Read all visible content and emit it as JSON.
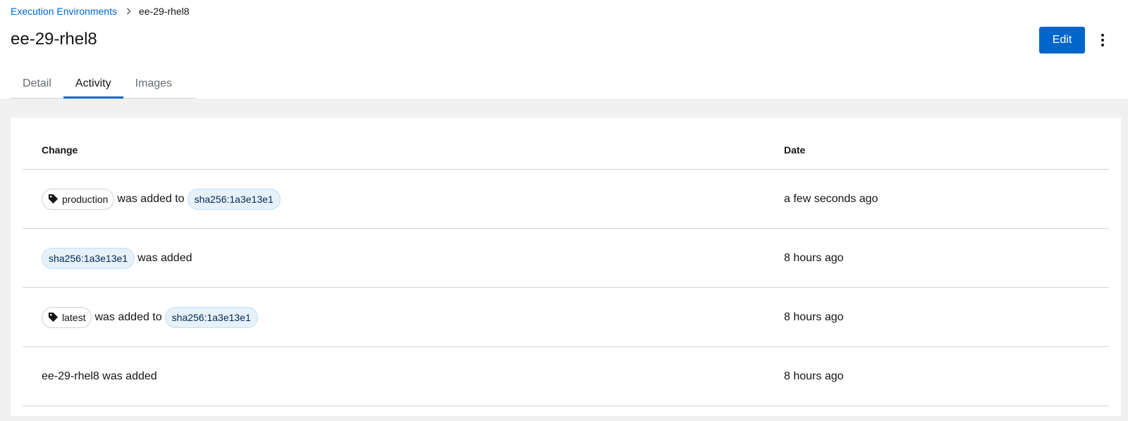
{
  "breadcrumb": {
    "parent": "Execution Environments",
    "current": "ee-29-rhel8"
  },
  "page_title": "ee-29-rhel8",
  "actions": {
    "edit_label": "Edit"
  },
  "tabs": [
    {
      "label": "Detail"
    },
    {
      "label": "Activity"
    },
    {
      "label": "Images"
    }
  ],
  "activity_table": {
    "headers": {
      "change": "Change",
      "date": "Date"
    },
    "rows": [
      {
        "tag": "production",
        "text": "was added to",
        "digest": "sha256:1a3e13e1",
        "date": "a few seconds ago"
      },
      {
        "digest": "sha256:1a3e13e1",
        "text": "was added",
        "date": "8 hours ago"
      },
      {
        "tag": "latest",
        "text": "was added to",
        "digest": "sha256:1a3e13e1",
        "date": "8 hours ago"
      },
      {
        "text": "ee-29-rhel8 was added",
        "date": "8 hours ago"
      }
    ]
  },
  "colors": {
    "accent": "#0066cc",
    "digest_bg": "#e7f1fa",
    "page_bg": "#f0f0f0"
  },
  "icons": {
    "breadcrumb_separator": "chevron-right-icon",
    "tag": "tag-icon",
    "overflow": "kebab-menu-icon"
  }
}
